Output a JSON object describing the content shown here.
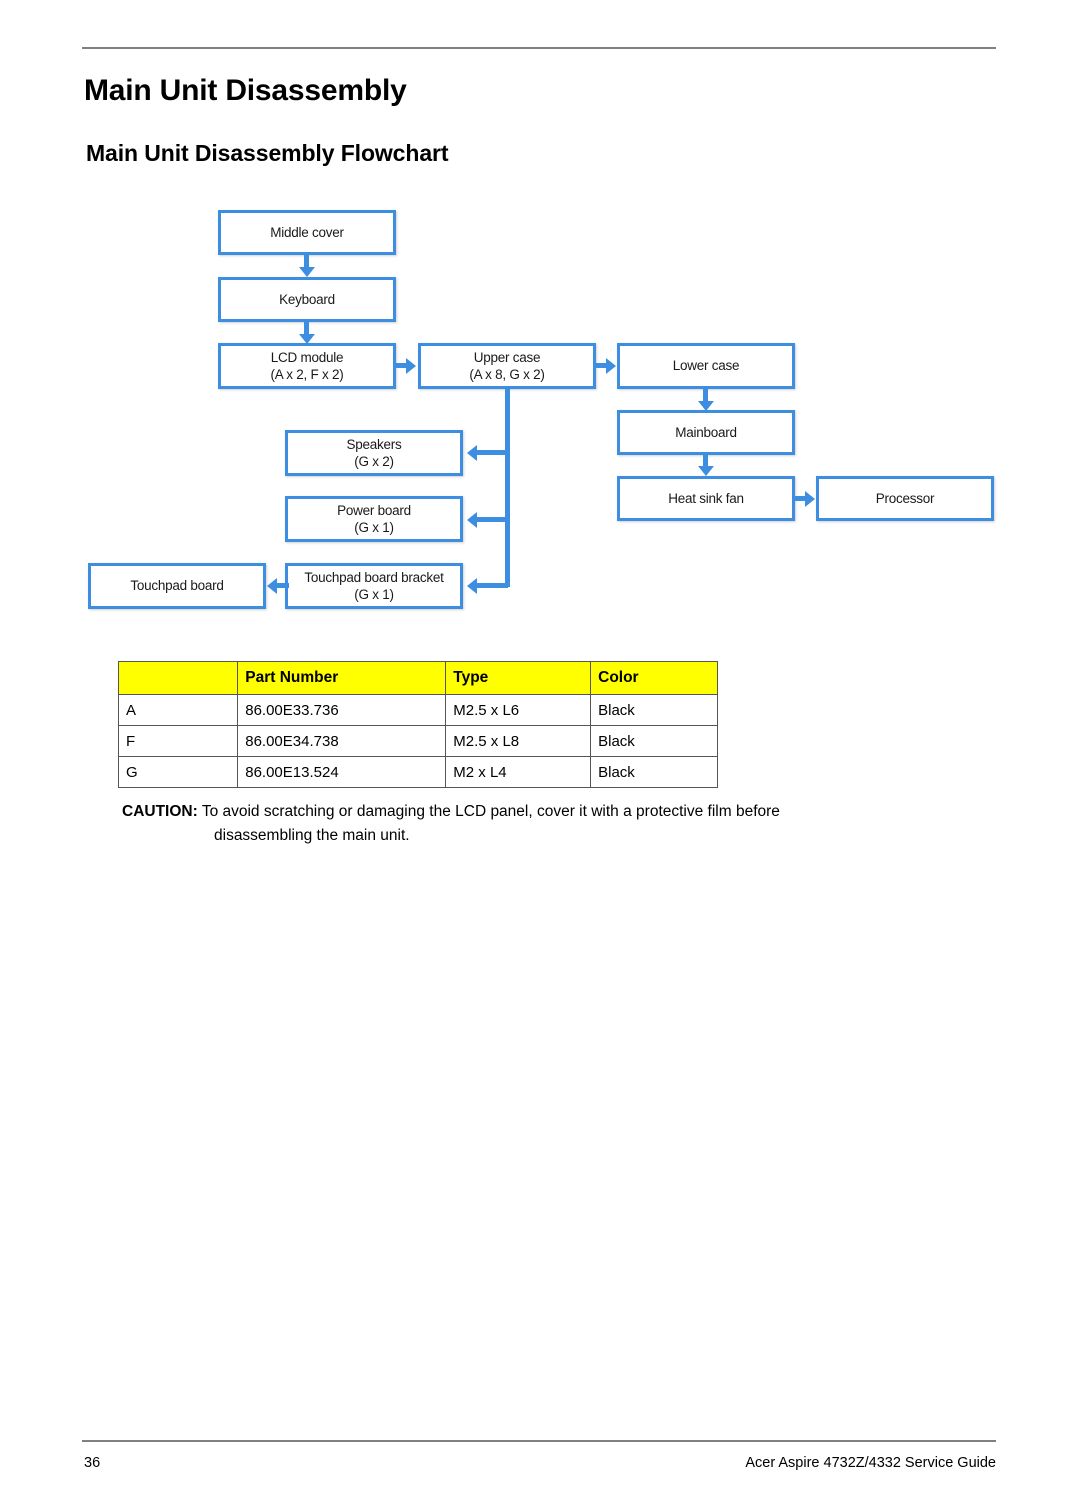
{
  "document": {
    "heading": "Main Unit Disassembly",
    "subheading": "Main Unit Disassembly Flowchart"
  },
  "flowchart": {
    "nodes": [
      {
        "id": "middle-cover",
        "line1": "Middle cover",
        "line2": ""
      },
      {
        "id": "keyboard",
        "line1": "Keyboard",
        "line2": ""
      },
      {
        "id": "lcd-module",
        "line1": "LCD module",
        "line2": "(A x 2, F x 2)"
      },
      {
        "id": "upper-case",
        "line1": "Upper case",
        "line2": "(A x 8, G x 2)"
      },
      {
        "id": "lower-case",
        "line1": "Lower case",
        "line2": ""
      },
      {
        "id": "mainboard",
        "line1": "Mainboard",
        "line2": ""
      },
      {
        "id": "heat-sink-fan",
        "line1": "Heat sink fan",
        "line2": ""
      },
      {
        "id": "processor",
        "line1": "Processor",
        "line2": ""
      },
      {
        "id": "speakers",
        "line1": "Speakers",
        "line2": "(G x 2)"
      },
      {
        "id": "power-board",
        "line1": "Power board",
        "line2": "(G x 1)"
      },
      {
        "id": "touchpad-board-bracket",
        "line1": "Touchpad board bracket",
        "line2": "(G x 1)"
      },
      {
        "id": "touchpad-board",
        "line1": "Touchpad board",
        "line2": ""
      }
    ],
    "accent_color": "#3d8ee0"
  },
  "parts_table": {
    "headers": [
      "",
      "Part Number",
      "Type",
      "Color"
    ],
    "rows": [
      {
        "key": "A",
        "part_number": "86.00E33.736",
        "type": "M2.5 x L6",
        "color": "Black"
      },
      {
        "key": "F",
        "part_number": "86.00E34.738",
        "type": "M2.5 x L8",
        "color": "Black"
      },
      {
        "key": "G",
        "part_number": "86.00E13.524",
        "type": "M2 x L4",
        "color": "Black"
      }
    ],
    "header_background": "#ffff00"
  },
  "caution": {
    "label": "CAUTION:",
    "line1": "To avoid scratching or damaging the LCD panel, cover it with a protective film before",
    "line2": "disassembling the main unit."
  },
  "footer": {
    "page_number": "36",
    "guide_title": "Acer Aspire 4732Z/4332 Service Guide"
  }
}
